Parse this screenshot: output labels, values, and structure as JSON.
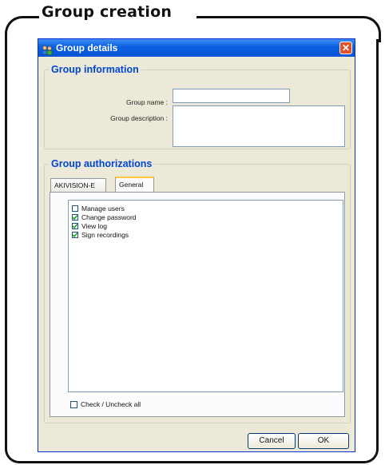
{
  "frame": {
    "title": "Group creation"
  },
  "dialog": {
    "title": "Group details",
    "close_symbol": "✕",
    "icon": "group-icon"
  },
  "group_information": {
    "legend": "Group information",
    "name_label": "Group name :",
    "name_value": "",
    "description_label": "Group description :",
    "description_value": ""
  },
  "group_authorizations": {
    "legend": "Group authorizations",
    "tabs": [
      {
        "label": "AKIVISION-E",
        "active": false
      },
      {
        "label": "General",
        "active": true
      }
    ],
    "permissions": [
      {
        "label": "Manage users",
        "checked": false
      },
      {
        "label": "Change password",
        "checked": true
      },
      {
        "label": "View log",
        "checked": true
      },
      {
        "label": "Sign recordings",
        "checked": true
      }
    ],
    "check_all_label": "Check / Uncheck all",
    "check_all_checked": false
  },
  "buttons": {
    "cancel": "Cancel",
    "ok": "OK"
  }
}
